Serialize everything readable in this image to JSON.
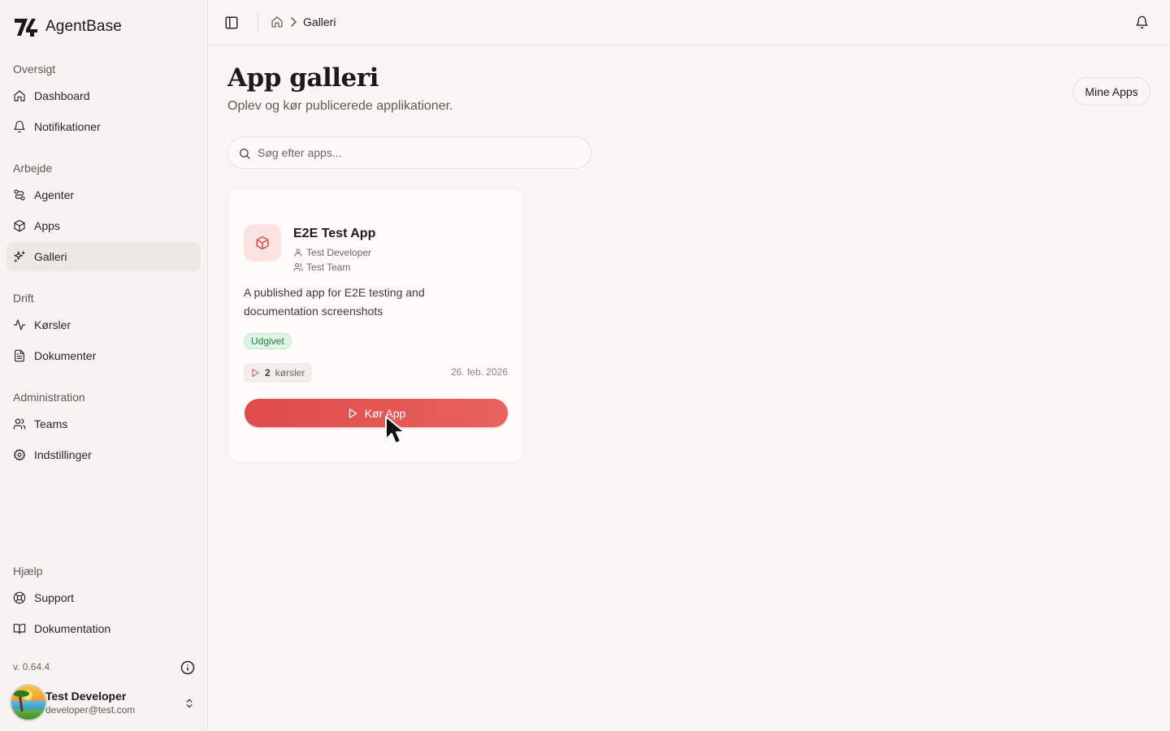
{
  "brand": {
    "name": "AgentBase"
  },
  "sidebar": {
    "sections": [
      {
        "label": "Oversigt",
        "items": [
          {
            "label": "Dashboard",
            "icon": "home-icon"
          },
          {
            "label": "Notifikationer",
            "icon": "bell-icon"
          }
        ]
      },
      {
        "label": "Arbejde",
        "items": [
          {
            "label": "Agenter",
            "icon": "route-icon"
          },
          {
            "label": "Apps",
            "icon": "box-icon"
          },
          {
            "label": "Galleri",
            "icon": "sparkles-icon",
            "active": true
          }
        ]
      },
      {
        "label": "Drift",
        "items": [
          {
            "label": "Kørsler",
            "icon": "activity-icon"
          },
          {
            "label": "Dokumenter",
            "icon": "document-icon"
          }
        ]
      },
      {
        "label": "Administration",
        "items": [
          {
            "label": "Teams",
            "icon": "users-icon"
          },
          {
            "label": "Indstillinger",
            "icon": "gear-icon"
          }
        ]
      },
      {
        "label": "Hjælp",
        "items": [
          {
            "label": "Support",
            "icon": "lifebuoy-icon"
          },
          {
            "label": "Dokumentation",
            "icon": "book-icon"
          }
        ]
      }
    ],
    "version": "v. 0.64.4",
    "user": {
      "name": "Test Developer",
      "email": "developer@test.com"
    }
  },
  "topbar": {
    "breadcrumb": {
      "current": "Galleri"
    }
  },
  "page": {
    "title": "App galleri",
    "subtitle": "Oplev og kør publicerede applikationer.",
    "mine_apps_label": "Mine Apps",
    "search": {
      "placeholder": "Søg efter apps...",
      "value": ""
    }
  },
  "apps": [
    {
      "name": "E2E Test App",
      "developer": "Test Developer",
      "team": "Test Team",
      "description": "A published app for E2E testing and documentation screenshots",
      "status": "Udgivet",
      "runs_count": "2",
      "runs_label": "kørsler",
      "date": "26. feb. 2026",
      "run_label": "Kør App"
    }
  ],
  "colors": {
    "accent": "#de4b4b",
    "status_green": "#2b7a48",
    "background": "#f8f7f4"
  }
}
